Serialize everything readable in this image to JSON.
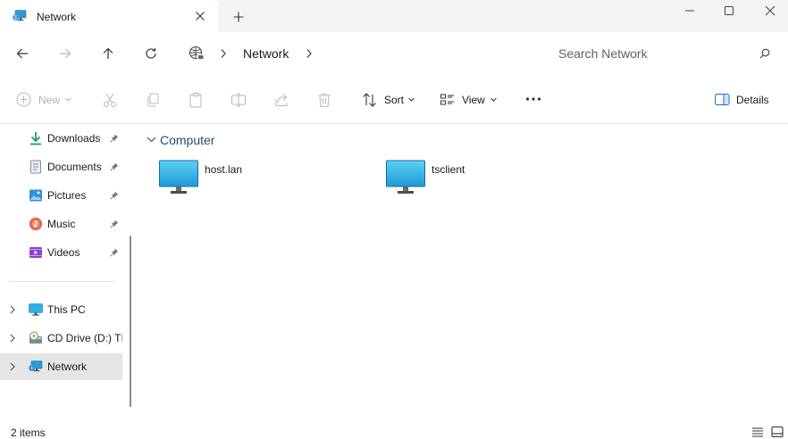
{
  "tab": {
    "title": "Network",
    "icon": "network-icon"
  },
  "window": {
    "minimize_icon": "minimize-icon",
    "maximize_icon": "maximize-icon",
    "close_icon": "close-icon"
  },
  "address": {
    "location": "Network",
    "search_placeholder": "Search Network"
  },
  "commands": {
    "new": "New",
    "sort": "Sort",
    "view": "View",
    "details": "Details"
  },
  "sidebar": {
    "pinned": [
      {
        "label": "Downloads",
        "icon": "downloads-icon"
      },
      {
        "label": "Documents",
        "icon": "documents-icon"
      },
      {
        "label": "Pictures",
        "icon": "pictures-icon"
      },
      {
        "label": "Music",
        "icon": "music-icon"
      },
      {
        "label": "Videos",
        "icon": "videos-icon"
      }
    ],
    "tree": [
      {
        "label": "This PC",
        "icon": "this-pc-icon"
      },
      {
        "label": "CD Drive (D:) TIN",
        "icon": "cd-drive-icon"
      },
      {
        "label": "Network",
        "icon": "network-icon",
        "selected": true
      }
    ]
  },
  "content": {
    "group_title": "Computer",
    "items": [
      {
        "label": "host.lan",
        "icon": "computer-icon"
      },
      {
        "label": "tsclient",
        "icon": "computer-icon"
      }
    ]
  },
  "status": {
    "item_count": "2 items"
  },
  "colors": {
    "accent": "#0067c0",
    "group_title": "#1f4e79",
    "selected_bg": "#e5e5e5",
    "tabstrip_bg": "#f3f3f3"
  }
}
